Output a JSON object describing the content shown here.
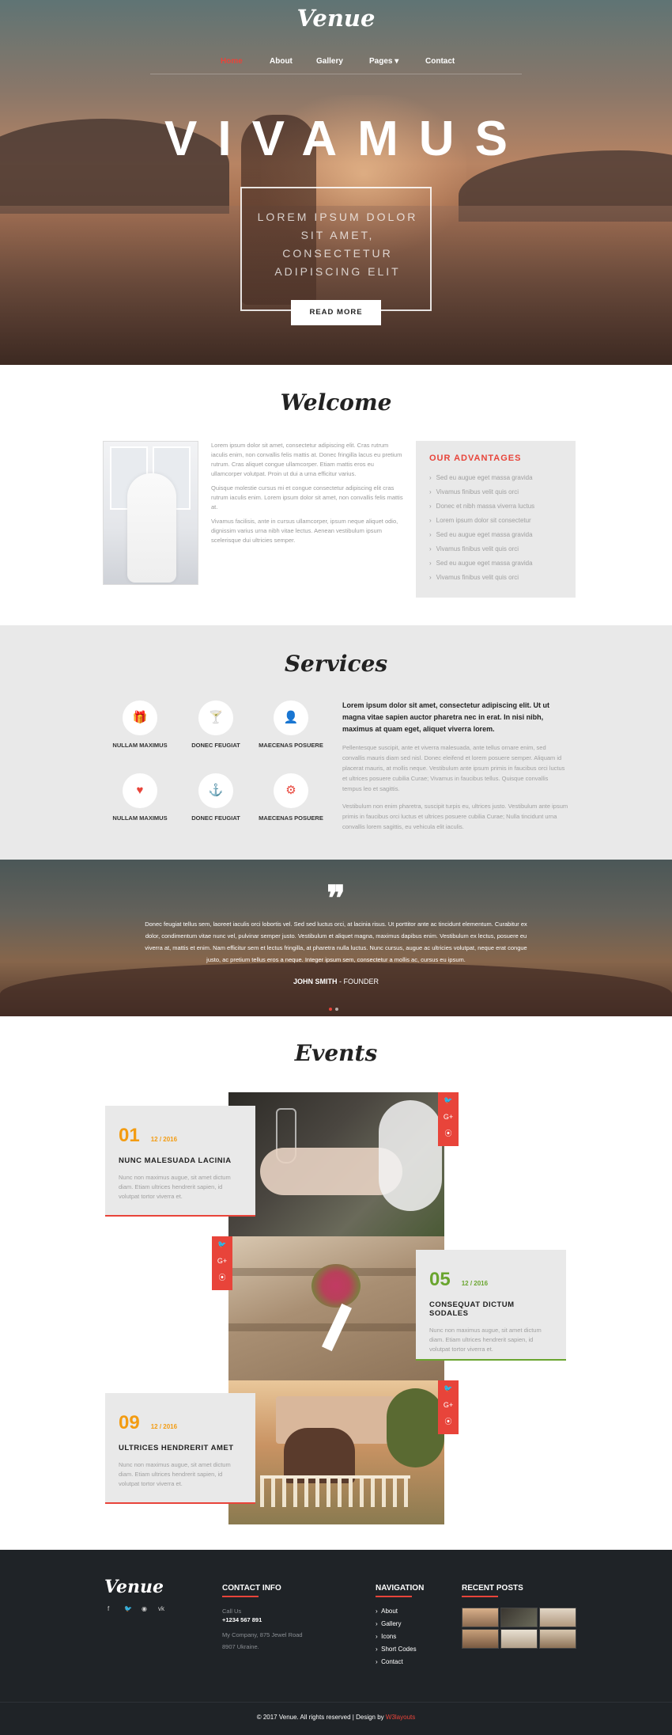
{
  "brand": {
    "logo": "Venue",
    "accent": "#e8443a"
  },
  "nav": {
    "items": [
      {
        "label": "Home"
      },
      {
        "label": "About"
      },
      {
        "label": "Gallery"
      },
      {
        "label": "Pages ▾"
      },
      {
        "label": "Contact"
      }
    ]
  },
  "hero": {
    "title": "VIVAMUS",
    "box_text": "LOREM IPSUM DOLOR SIT AMET, CONSECTETUR ADIPISCING ELIT",
    "button": "READ MORE"
  },
  "welcome": {
    "title": "Welcome",
    "paragraphs": [
      "Lorem ipsum dolor sit amet, consectetur adipiscing elit. Cras rutrum iaculis enim, non convallis felis mattis at. Donec fringilla lacus eu pretium rutrum. Cras aliquet congue ullamcorper. Etiam mattis eros eu ullamcorper volutpat. Proin ut dui a urna efficitur varius.",
      "Quisque molestie cursus mi et congue consectetur adipiscing elit cras rutrum iaculis enim. Lorem ipsum dolor sit amet, non convallis felis mattis at.",
      "Vivamus facilisis, ante in cursus ullamcorper, ipsum neque aliquet odio, dignissim varius urna nibh vitae lectus. Aenean vestibulum ipsum scelerisque dui ultricies semper."
    ],
    "advantages_title": "OUR ADVANTAGES",
    "advantages": [
      "Sed eu augue eget massa gravida",
      "Vivamus finibus velit quis orci",
      "Donec et nibh massa viverra luctus",
      "Lorem ipsum dolor sit consectetur",
      "Sed eu augue eget massa gravida",
      "Vivamus finibus velit quis orci",
      "Sed eu augue eget massa gravida",
      "Vivamus finibus velit quis orci"
    ]
  },
  "services": {
    "title": "Services",
    "items": [
      {
        "label": "NULLAM MAXIMUS",
        "icon": "gift-icon",
        "glyph": "🎁"
      },
      {
        "label": "DONEC FEUGIAT",
        "icon": "cocktail-icon",
        "glyph": "🍸"
      },
      {
        "label": "MAECENAS POSUERE",
        "icon": "user-icon",
        "glyph": "👤"
      },
      {
        "label": "NULLAM MAXIMUS",
        "icon": "heart-icon",
        "glyph": "♥"
      },
      {
        "label": "DONEC FEUGIAT",
        "icon": "anchor-icon",
        "glyph": "⚓"
      },
      {
        "label": "MAECENAS POSUERE",
        "icon": "gear-icon",
        "glyph": "⚙"
      }
    ],
    "lead": "Lorem ipsum dolor sit amet, consectetur adipiscing elit. Ut ut magna vitae sapien auctor pharetra nec in erat. In nisi nibh, maximus at quam eget, aliquet viverra lorem.",
    "p1": "Pellentesque suscipit, ante et viverra malesuada, ante tellus ornare enim, sed convallis mauris diam sed nisl. Donec eleifend et lorem posuere semper. Aliquam id placerat mauris, at mollis neque. Vestibulum ante ipsum primis in faucibus orci luctus et ultrices posuere cubilia Curae; Vivamus in faucibus tellus. Quisque convallis tempus leo et sagittis.",
    "p2": "Vestibulum non enim pharetra, suscipit turpis eu, ultrices justo. Vestibulum ante ipsum primis in faucibus orci luctus et ultrices posuere cubilia Curae; Nulla tincidunt urna convallis lorem sagittis, eu vehicula elit iaculis."
  },
  "testimonial": {
    "quote_glyph": "❞",
    "text": "Donec feugiat tellus sem, laoreet iaculis orci lobortis vel. Sed sed luctus orci, at lacinia risus. Ut porttitor ante ac tincidunt elementum. Curabitur ex dolor, condimentum vitae nunc vel, pulvinar semper justo. Vestibulum et aliquet magna, maximus dapibus enim. Vestibulum ex lectus, posuere eu viverra at, mattis et enim. Nam efficitur sem et lectus fringilla, at pharetra nulla luctus. Nunc cursus, augue ac ultricies volutpat, neque erat congue justo, ac pretium tellus eros a neque. Integer ipsum sem, consectetur a mollis ac, cursus eu ipsum.",
    "name": "JOHN SMITH",
    "role": " - FOUNDER"
  },
  "events": {
    "title": "Events",
    "items": [
      {
        "num": "01",
        "date": "12 / 2016",
        "title": "NUNC MALESUADA LACINIA",
        "text": "Nunc non maximus augue, sit amet dictum diam. Etiam ultrices hendrerit sapien, id volutpat tortor viverra et.",
        "color": "#f39c12"
      },
      {
        "num": "05",
        "date": "12 / 2016",
        "title": "CONSEQUAT DICTUM SODALES",
        "text": "Nunc non maximus augue, sit amet dictum diam. Etiam ultrices hendrerit sapien, id volutpat tortor viverra et.",
        "color": "#6aa52f"
      },
      {
        "num": "09",
        "date": "12 / 2016",
        "title": "ULTRICES HENDRERIT AMET",
        "text": "Nunc non maximus augue, sit amet dictum diam. Etiam ultrices hendrerit sapien, id volutpat tortor viverra et.",
        "color": "#f39c12"
      }
    ],
    "social": [
      "🐦",
      "G+",
      "⦿"
    ]
  },
  "footer": {
    "logo": "Venue",
    "social": [
      "f",
      "🐦",
      "◉",
      "vk"
    ],
    "contact_title": "CONTACT INFO",
    "call_label": "Call Us",
    "phone": "+1234 567 891",
    "address1": "My Company, 875 Jewel Road",
    "address2": "8907 Ukraine.",
    "nav_title": "NAVIGATION",
    "nav_items": [
      "About",
      "Gallery",
      "Icons",
      "Short Codes",
      "Contact"
    ],
    "posts_title": "RECENT POSTS",
    "copyright": "© 2017 Venue. All rights reserved | Design by ",
    "designer": "W3layouts"
  }
}
